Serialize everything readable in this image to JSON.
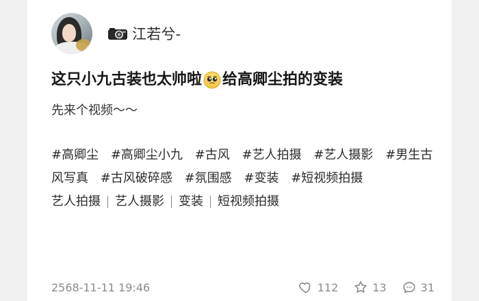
{
  "post": {
    "author": {
      "name": "江若兮-",
      "avatar_icon": "avatar-image",
      "name_prefix_icon": "camera-icon"
    },
    "title_part1": "这只小九古装也太帅啦",
    "title_emoji": "pleading-face-emoji",
    "title_part2": "给高卿尘拍的变装",
    "subline": "先来个视频～～",
    "tags": [
      "#高卿尘",
      "#高卿尘小九",
      "#古风",
      "#艺人拍摄",
      "#艺人摄影",
      "#男生古风写真",
      "#古风破碎感",
      "#氛围感",
      "#变装",
      "#短视频拍摄"
    ],
    "links": [
      "艺人拍摄",
      "艺人摄影",
      "变装",
      "短视频拍摄"
    ],
    "timestamp": "2568-11-11 19:46",
    "stats": {
      "likes": "112",
      "stars": "13",
      "comments": "31"
    }
  }
}
